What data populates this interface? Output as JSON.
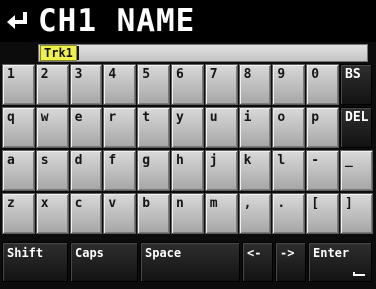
{
  "title": "CH1 NAME",
  "input": {
    "value": "Trk1"
  },
  "rows": [
    [
      "1",
      "2",
      "3",
      "4",
      "5",
      "6",
      "7",
      "8",
      "9",
      "0"
    ],
    [
      "q",
      "w",
      "e",
      "r",
      "t",
      "y",
      "u",
      "i",
      "o",
      "p"
    ],
    [
      "a",
      "s",
      "d",
      "f",
      "g",
      "h",
      "j",
      "k",
      "l",
      "-",
      "_"
    ],
    [
      "z",
      "x",
      "c",
      "v",
      "b",
      "n",
      "m",
      ",",
      ".",
      "[",
      "]"
    ]
  ],
  "side_keys": {
    "bs": "BS",
    "del": "DEL"
  },
  "bottom_keys": {
    "shift": "Shift",
    "caps": "Caps",
    "space": "Space",
    "left": "<-",
    "right": "->",
    "enter": "Enter"
  },
  "icons": {
    "back": "return-arrow-icon",
    "enter": "enter-arrow-icon"
  }
}
